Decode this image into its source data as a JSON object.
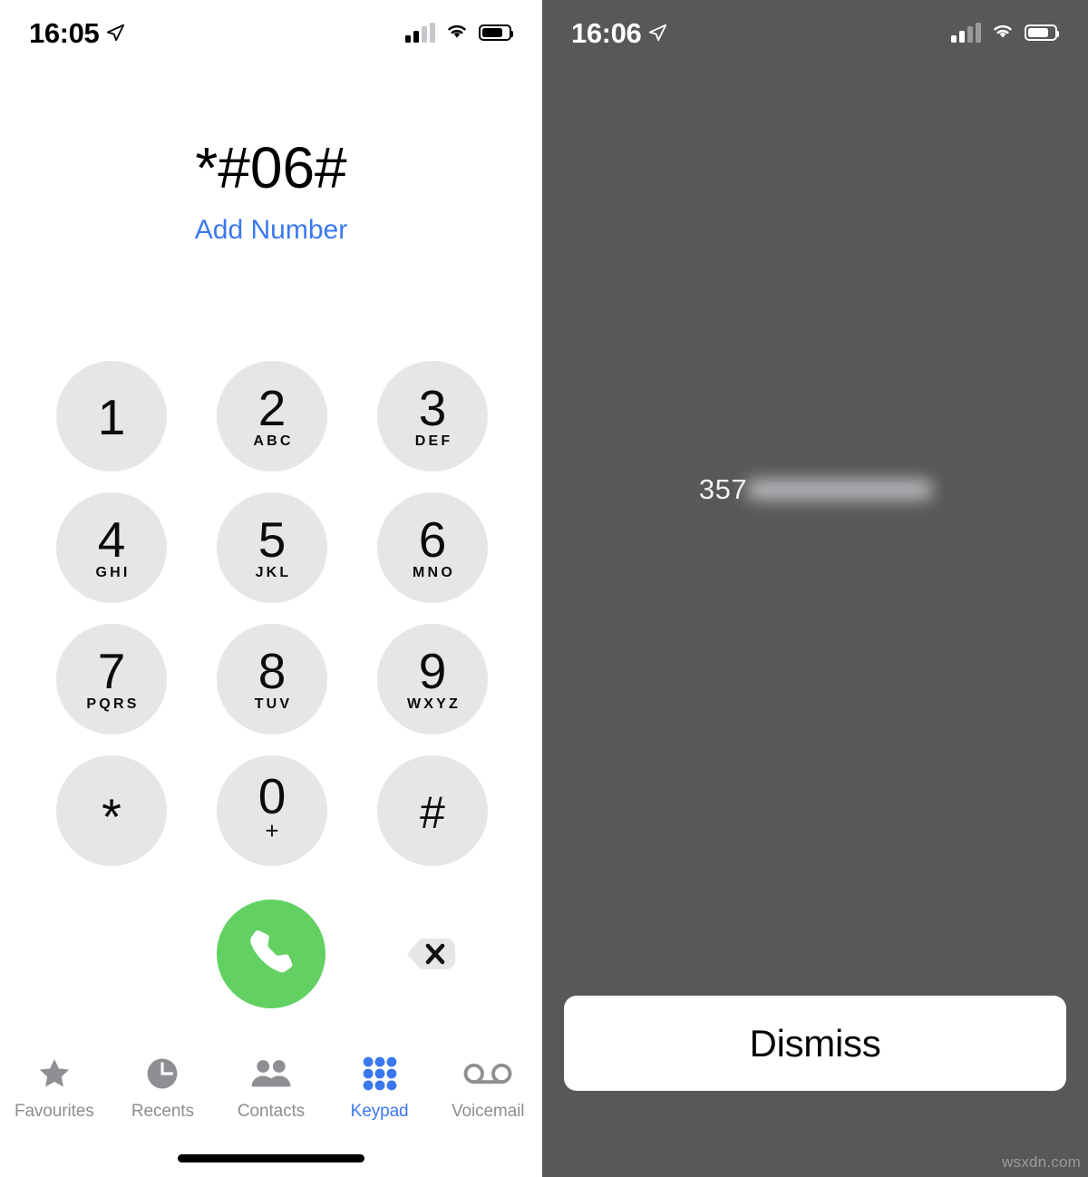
{
  "left_screen": {
    "status_bar": {
      "time": "16:05",
      "location_icon": "location-arrow-icon",
      "signal_icon": "cellular-signal-icon",
      "wifi_icon": "wifi-icon",
      "battery_icon": "battery-icon"
    },
    "dialed_number": "*#06#",
    "add_number_label": "Add Number",
    "keypad": [
      {
        "digit": "1",
        "letters": ""
      },
      {
        "digit": "2",
        "letters": "ABC"
      },
      {
        "digit": "3",
        "letters": "DEF"
      },
      {
        "digit": "4",
        "letters": "GHI"
      },
      {
        "digit": "5",
        "letters": "JKL"
      },
      {
        "digit": "6",
        "letters": "MNO"
      },
      {
        "digit": "7",
        "letters": "PQRS"
      },
      {
        "digit": "8",
        "letters": "TUV"
      },
      {
        "digit": "9",
        "letters": "WXYZ"
      },
      {
        "digit": "*",
        "letters": ""
      },
      {
        "digit": "0",
        "letters": "+"
      },
      {
        "digit": "#",
        "letters": ""
      }
    ],
    "call_button_icon": "phone-handset-icon",
    "delete_button_icon": "backspace-delete-icon",
    "tabs": [
      {
        "label": "Favourites",
        "icon": "star-icon",
        "active": false
      },
      {
        "label": "Recents",
        "icon": "clock-icon",
        "active": false
      },
      {
        "label": "Contacts",
        "icon": "people-icon",
        "active": false
      },
      {
        "label": "Keypad",
        "icon": "keypad-dots-icon",
        "active": true
      },
      {
        "label": "Voicemail",
        "icon": "voicemail-icon",
        "active": false
      }
    ]
  },
  "right_screen": {
    "status_bar": {
      "time": "16:06",
      "location_icon": "location-arrow-icon",
      "signal_icon": "cellular-signal-icon",
      "wifi_icon": "wifi-icon",
      "battery_icon": "battery-icon"
    },
    "imei_visible_digits": "357",
    "imei_redacted": true,
    "dismiss_label": "Dismiss"
  },
  "watermark": "wsxdn.com",
  "colors": {
    "accent_blue": "#3b78f0",
    "call_green": "#62d162",
    "key_gray": "#e6e6e6",
    "tab_inactive": "#8e8e93",
    "overlay_gray": "#58585a"
  }
}
